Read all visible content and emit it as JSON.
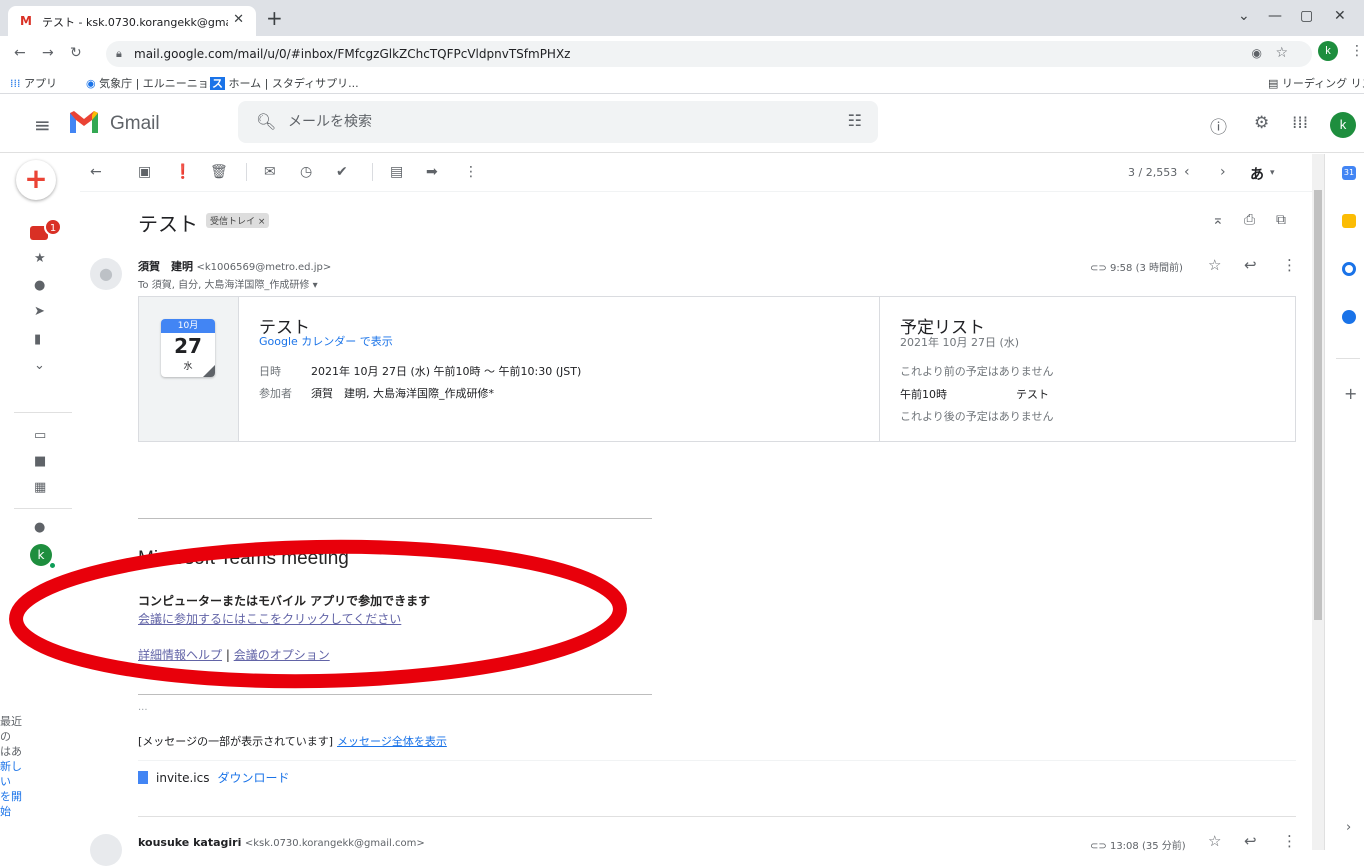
{
  "browser": {
    "tab_title": "テスト - ksk.0730.korangekk@gma",
    "url": "mail.google.com/mail/u/0/#inbox/FMfcgzGlkZChcTQFPcVldpnvTSfmPHXz",
    "profile_initial": "k",
    "bookmarks": [
      "アプリ",
      "気象庁 | エルニーニョ...",
      "ホーム | スタディサプリ...",
      "リーディング リスト"
    ]
  },
  "gmail": {
    "app_name": "Gmail",
    "search_placeholder": "メールを検索",
    "avatar_initial": "k",
    "inbox_badge": "1"
  },
  "toolbar": {
    "pager": "3 / 2,553",
    "input_tool": "あ"
  },
  "message": {
    "subject": "テスト",
    "label_chip": "受信トレイ ×",
    "sender_name": "須賀　建明",
    "sender_email": "<k1006569@metro.ed.jp>",
    "to_line": "To 須賀, 自分, 大島海洋国際_作成研修 ▾",
    "time": "9:58 (3 時間前)"
  },
  "event": {
    "month": "10月",
    "day": "27",
    "weekday": "水",
    "title": "テスト",
    "calendar_link": "Google カレンダー で表示",
    "when_label": "日時",
    "when": "2021年 10月 27日 (水) 午前10時 ～ 午前10:30 (JST)",
    "who_label": "参加者",
    "who": "須賀　建明, 大島海洋国際_作成研修*"
  },
  "schedule": {
    "title": "予定リスト",
    "date": "2021年 10月 27日 (水)",
    "before": "これより前の予定はありません",
    "time": "午前10時",
    "event": "テスト",
    "after": "これより後の予定はありません"
  },
  "teams": {
    "title": "Microsoft Teams meeting",
    "join_heading": "コンピューターまたはモバイル アプリで参加できます",
    "join_link": "会議に参加するにはここをクリックしてください",
    "help_link": "詳細情報ヘルプ",
    "separator": " | ",
    "options_link": "会議のオプション"
  },
  "footer": {
    "ellipsis": "...",
    "clipped_text": "[メッセージの一部が表示されています]",
    "clipped_link": "メッセージ全体を表示",
    "attachment_name": "invite.ics",
    "download_link": "ダウンロード"
  },
  "next_message": {
    "sender_name": "kousuke katagiri",
    "sender_email": "<ksk.0730.korangekk@gmail.com>",
    "time": "13:08 (35 分前)"
  },
  "rail_note": {
    "line1": "最近の",
    "line2": "はあ",
    "line3": "新しい",
    "line4": "を開始"
  },
  "colors": {
    "annotation_red": "#e8000b",
    "gmail_red": "#d93025",
    "link_blue": "#1a73e8",
    "teams_purple": "#6264a7"
  }
}
